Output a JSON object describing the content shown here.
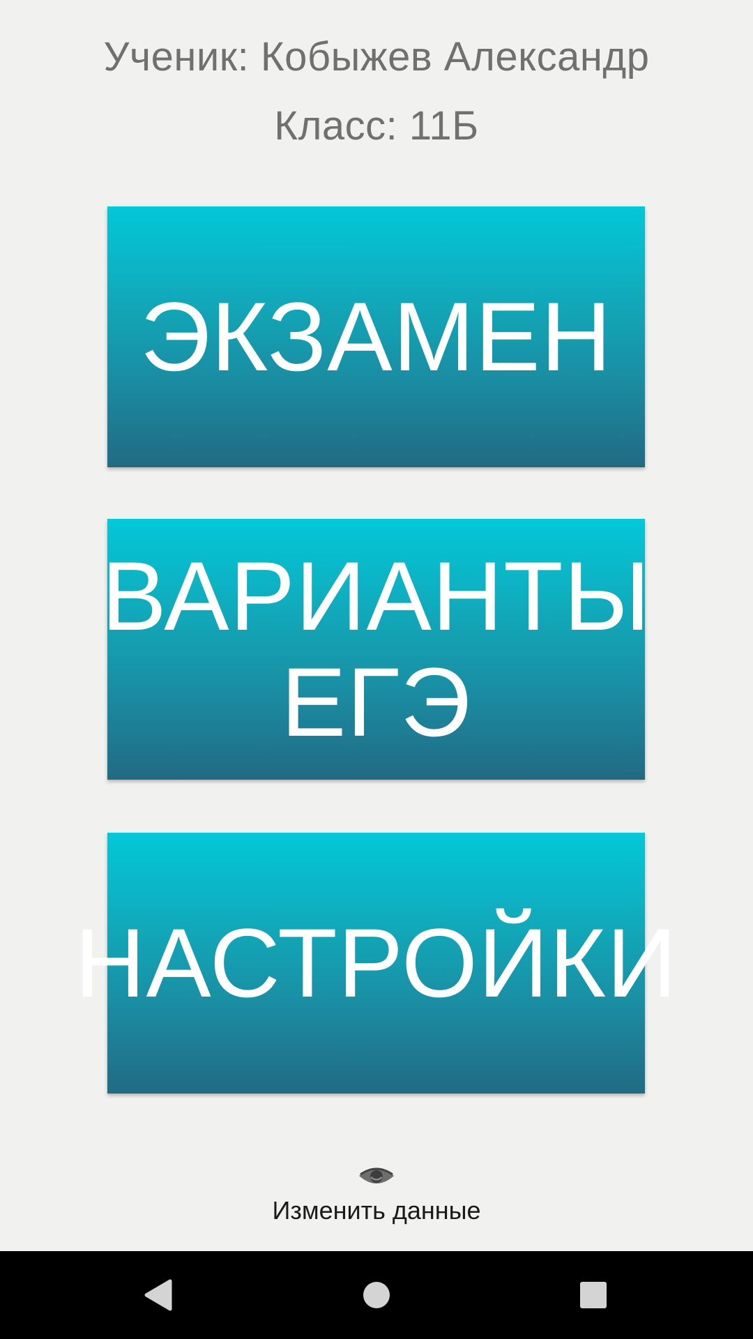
{
  "student": {
    "name_line": "Ученик: Кобыжев Александр",
    "class_line": "Класс: 11Б"
  },
  "menu": {
    "exam_label": "ЭКЗАМЕН",
    "variants_label_line1": "ВАРИАНТЫ",
    "variants_label_line2": "ЕГЭ",
    "settings_label": "НАСТРОЙКИ"
  },
  "footer": {
    "change_data_label": "Изменить данные",
    "icon": "eye-icon"
  },
  "navigation": {
    "back_icon": "back-triangle-icon",
    "home_icon": "home-circle-icon",
    "recents_icon": "recents-square-icon"
  },
  "colors": {
    "background": "#f1f2f0",
    "button_gradient_top": "#02c8d9",
    "button_gradient_bottom": "#216a84",
    "button_text": "#ffffff",
    "header_text": "#707070",
    "nav_bar": "#000000"
  }
}
